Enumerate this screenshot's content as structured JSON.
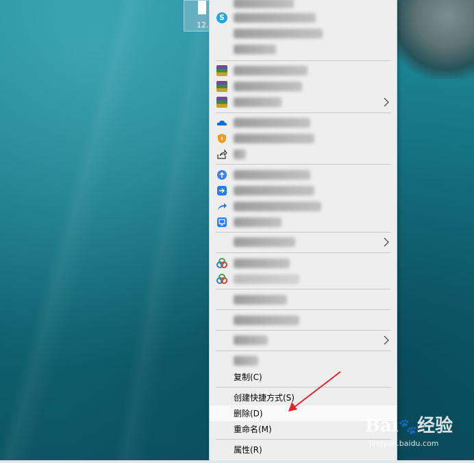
{
  "desktop": {
    "file_label": "12.",
    "wallpaper": "underwater ocean with sea turtle"
  },
  "context_menu": {
    "items_visible": [
      {
        "id": "copy",
        "label": "复制(C)"
      },
      {
        "id": "create_shortcut",
        "label": "创建快捷方式(S)"
      },
      {
        "id": "delete",
        "label": "删除(D)"
      },
      {
        "id": "rename",
        "label": "重命名(M)"
      },
      {
        "id": "properties",
        "label": "属性(R)"
      }
    ],
    "highlighted_item": "删除(D)",
    "icons": {
      "skype": "S",
      "winrar": "winrar-icon",
      "onedrive": "onedrive-icon",
      "shield": "shield-icon",
      "share": "share-icon",
      "upload": "upload-icon",
      "send": "send-icon",
      "share-link": "share-link-icon",
      "screen": "screen-icon",
      "baidu-netdisk": "baidu-netdisk-icon"
    },
    "colors": {
      "menu_bg": "#eeeeee",
      "highlight_bg": "#fafafa",
      "arrow": "#e0242a"
    }
  },
  "watermark": {
    "brand": "Bai",
    "brand_cn": "经验",
    "url": "jingyan.baidu.com"
  }
}
